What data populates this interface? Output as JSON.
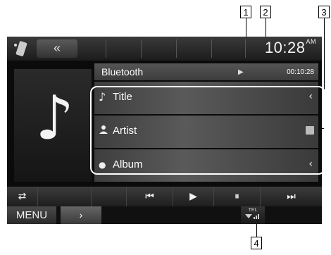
{
  "callouts": [
    "1",
    "2",
    "3",
    "4"
  ],
  "topbar": {
    "source_icon": "music-source-icon",
    "back_label": "«",
    "clock": "10:28",
    "clock_suffix": "AM"
  },
  "source_bar": {
    "name": "Bluetooth",
    "play_state": "▶",
    "elapsed": "00:10:28"
  },
  "track_info": [
    {
      "icon": "♪",
      "label": "Title",
      "action": "‹"
    },
    {
      "icon": "👤",
      "label": "Artist",
      "action": ""
    },
    {
      "icon": "●",
      "label": "Album",
      "action": "‹"
    }
  ],
  "controls": {
    "repeat": "⇄",
    "prev": "⏮",
    "play": "▶",
    "pause": "⏸",
    "next": "⏭"
  },
  "bottom": {
    "menu": "MENU",
    "next_page": "›",
    "tel": "TEL"
  },
  "colors": {
    "screen_bg": "#0b0b0b",
    "row_bg": "#4a4a4a",
    "highlight": "#ffffff"
  }
}
